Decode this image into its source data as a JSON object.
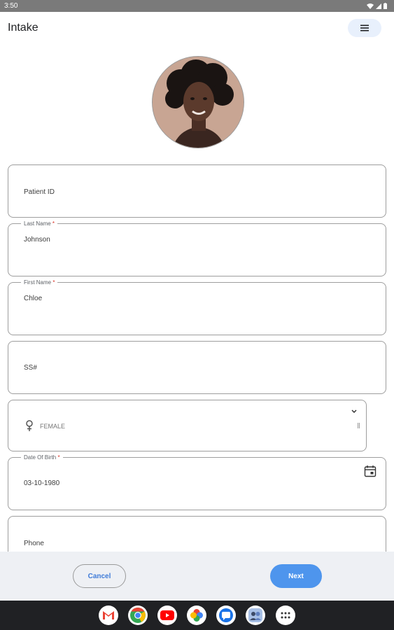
{
  "status_bar": {
    "time": "3:50"
  },
  "app_bar": {
    "title": "Intake",
    "menu_icon": "hamburger-menu-icon"
  },
  "avatar": {
    "icon": "patient-avatar"
  },
  "form": {
    "patient_id": {
      "placeholder": "Patient ID"
    },
    "last_name": {
      "label": "Last Name",
      "required_mark": "*",
      "value": "Johnson"
    },
    "first_name": {
      "label": "First Name",
      "required_mark": "*",
      "value": "Chloe"
    },
    "ssn": {
      "placeholder": "SS#"
    },
    "gender": {
      "selected": "FEMALE",
      "icon": "female-icon"
    },
    "date_of_birth": {
      "label": "Date Of Birth",
      "required_mark": "*",
      "value": "03-10-1980",
      "icon": "calendar-icon"
    },
    "phone": {
      "placeholder": "Phone"
    }
  },
  "actions": {
    "cancel_label": "Cancel",
    "next_label": "Next",
    "accent": "#4e95ed"
  },
  "taskbar": {
    "apps": [
      "gmail-icon",
      "chrome-icon",
      "youtube-icon",
      "photos-icon",
      "messages-icon",
      "contacts-icon",
      "app-drawer-icon"
    ]
  }
}
